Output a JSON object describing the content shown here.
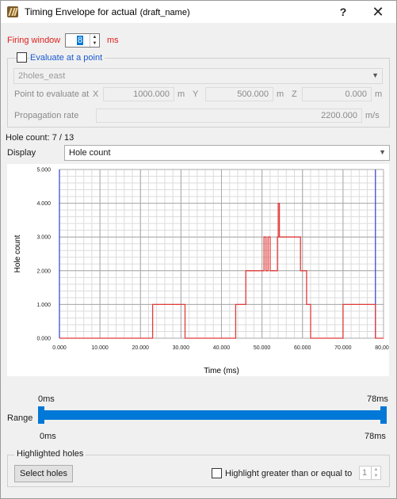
{
  "window": {
    "title": "Timing Envelope for actual",
    "subtitle": "(draft_name)",
    "help": "?",
    "close": "✕"
  },
  "firing": {
    "label": "Firing window",
    "value": "8",
    "unit": "ms"
  },
  "evaluate": {
    "checkbox_label": "Evaluate at a point",
    "checked": false,
    "hole_select": "2holes_east",
    "point_label": "Point to evaluate at",
    "x_label": "X",
    "x_value": "1000.000",
    "x_unit": "m",
    "y_label": "Y",
    "y_value": "500.000",
    "y_unit": "m",
    "z_label": "Z",
    "z_value": "0.000",
    "z_unit": "m",
    "prop_label": "Propagation rate",
    "prop_value": "2200.000",
    "prop_unit": "m/s"
  },
  "hole_count": "Hole count: 7 / 13",
  "display": {
    "label": "Display",
    "selected": "Hole count"
  },
  "chart_data": {
    "type": "line",
    "step": true,
    "xlabel": "Time (ms)",
    "ylabel": "Hole count",
    "xlim": [
      0,
      80000
    ],
    "ylim": [
      0,
      5
    ],
    "x_ticks": [
      "0.000",
      "10.000",
      "20.000",
      "30.000",
      "40.000",
      "50.000",
      "60.000",
      "70.000",
      "80,000"
    ],
    "y_ticks": [
      "0.000",
      "1.000",
      "2.000",
      "3.000",
      "4.000",
      "5.000"
    ],
    "grid": true,
    "range_markers_x": [
      0,
      78000
    ],
    "series_color": "#e23b3b",
    "points": [
      [
        0,
        0
      ],
      [
        23000,
        0
      ],
      [
        23000,
        1
      ],
      [
        31000,
        1
      ],
      [
        31000,
        0
      ],
      [
        43500,
        0
      ],
      [
        43500,
        1
      ],
      [
        46000,
        1
      ],
      [
        46000,
        2
      ],
      [
        50500,
        2
      ],
      [
        50500,
        3
      ],
      [
        51000,
        3
      ],
      [
        51000,
        2
      ],
      [
        51500,
        2
      ],
      [
        51500,
        3
      ],
      [
        52000,
        3
      ],
      [
        52000,
        2
      ],
      [
        53800,
        2
      ],
      [
        53800,
        3
      ],
      [
        54000,
        3
      ],
      [
        54000,
        4
      ],
      [
        54300,
        4
      ],
      [
        54300,
        3
      ],
      [
        59500,
        3
      ],
      [
        59500,
        2
      ],
      [
        61000,
        2
      ],
      [
        61000,
        1
      ],
      [
        62000,
        1
      ],
      [
        62000,
        0
      ],
      [
        70000,
        0
      ],
      [
        70000,
        1
      ],
      [
        78000,
        1
      ],
      [
        78000,
        0
      ],
      [
        80000,
        0
      ]
    ]
  },
  "range": {
    "label": "Range",
    "top_min": "0ms",
    "top_max": "78ms",
    "bottom_min": "0ms",
    "bottom_max": "78ms",
    "low_fraction": 0.0,
    "high_fraction": 1.0
  },
  "highlighted": {
    "group_label": "Highlighted holes",
    "select_button": "Select holes",
    "highlight_label": "Highlight greater than or equal to",
    "highlight_checked": false,
    "highlight_value": "1"
  },
  "colors": {
    "accent": "#0078d7",
    "warning_text": "#e0201e",
    "link_text": "#1a5ad0",
    "plot_line": "#e23b3b",
    "axis": "#3040d0"
  }
}
